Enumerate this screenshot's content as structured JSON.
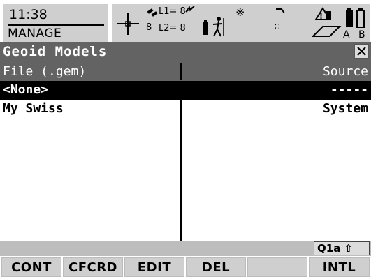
{
  "status": {
    "time": "11:38",
    "mode": "MANAGE",
    "l1_label": "L1= 8",
    "l2_label": "L2= 8",
    "sat_count": "8",
    "memory_letters": "A B",
    "icons": [
      "crosshair-icon",
      "satellite-icon",
      "battery-walk-icon",
      "bluetooth-icon",
      "link-icon",
      "memory-icon",
      "battery-icon"
    ]
  },
  "title_bar": {
    "title": "Geoid Models",
    "close_icon": "close-icon"
  },
  "table": {
    "headers": {
      "file": "File (.gem)",
      "source": "Source"
    },
    "rows": [
      {
        "file": "<None>",
        "source": "-----",
        "selected": true
      },
      {
        "file": "My Swiss",
        "source": "System",
        "selected": false
      }
    ]
  },
  "input_mode": "Q1a ⇧",
  "softkeys": [
    "CONT",
    "CFCRD",
    "EDIT",
    "DEL",
    "",
    "INTL"
  ]
}
